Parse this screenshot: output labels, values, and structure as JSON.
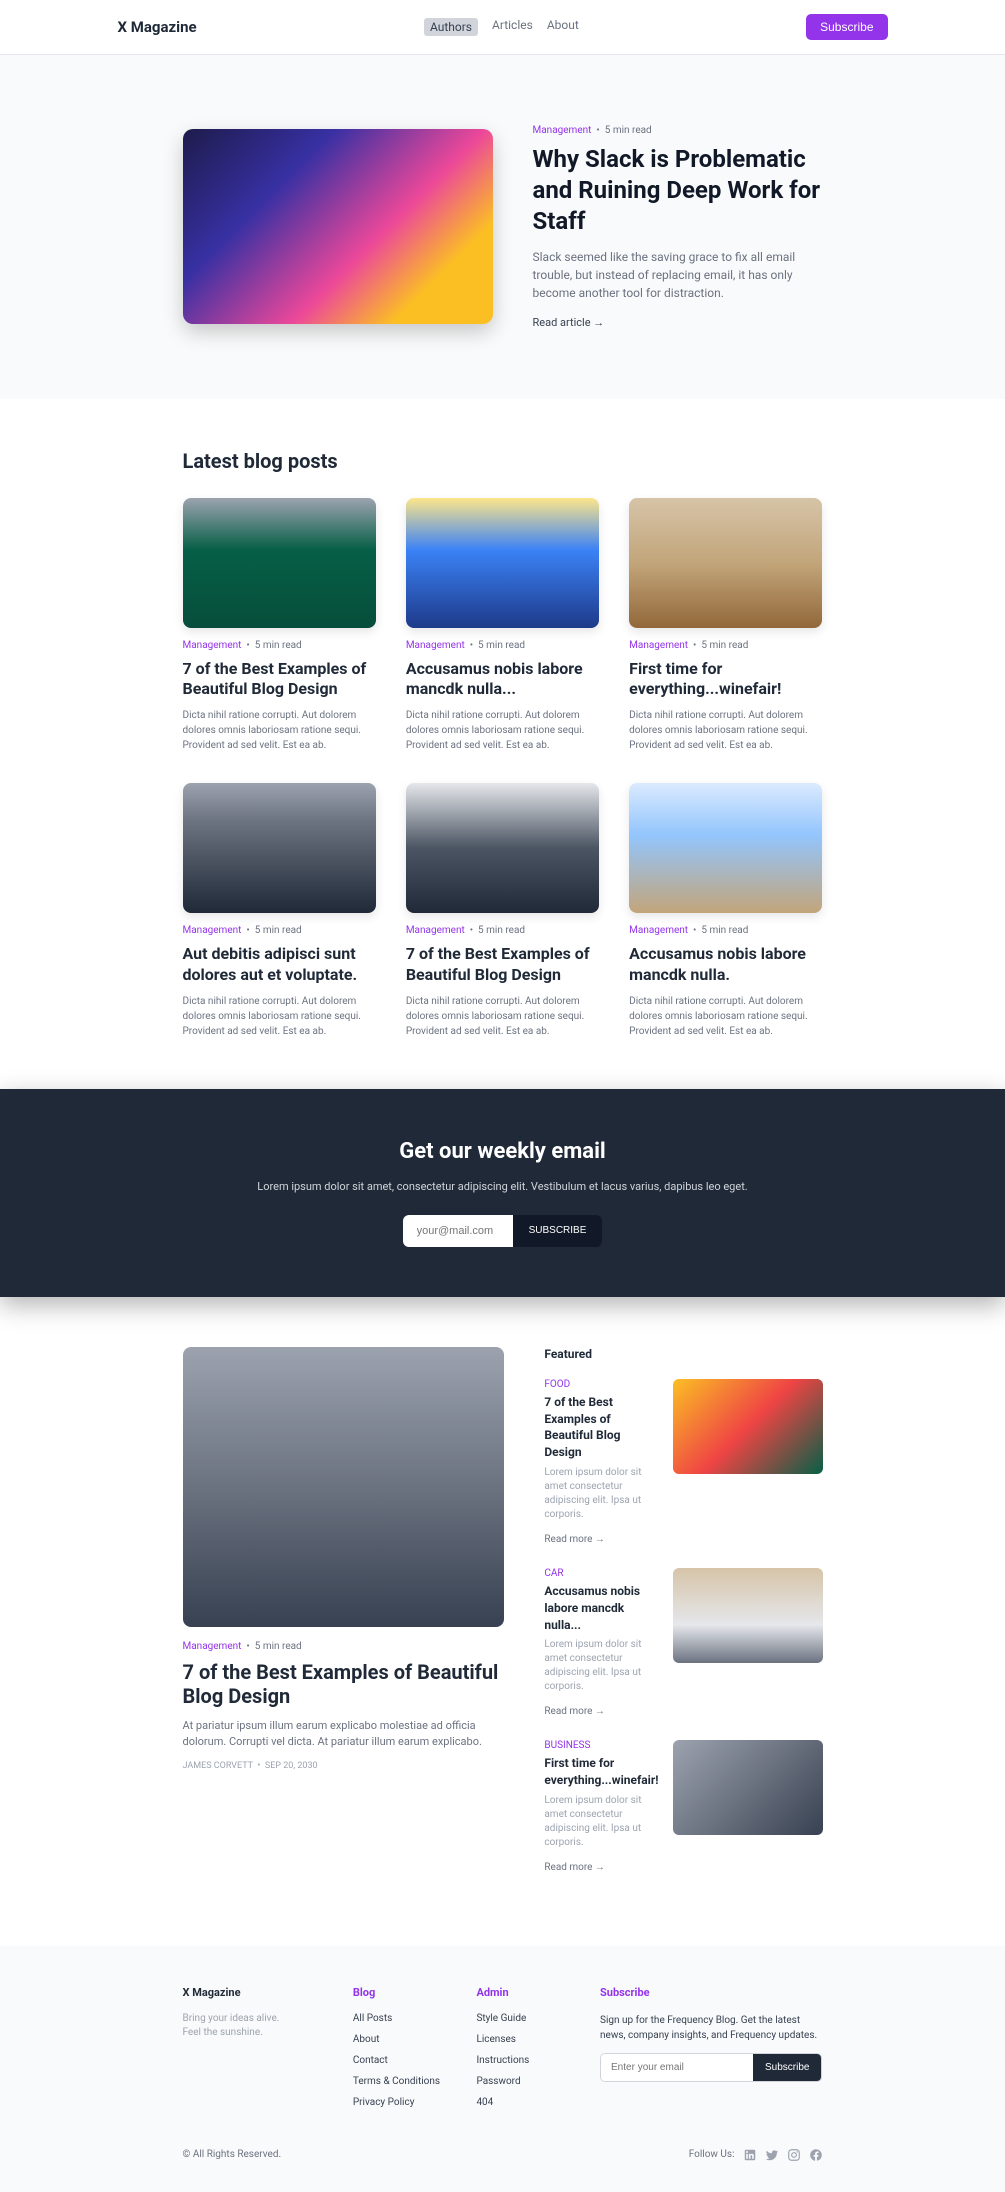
{
  "brand": "X Magazine",
  "nav": {
    "authors": "Authors",
    "articles": "Articles",
    "about": "About"
  },
  "subscribe_btn": "Subscribe",
  "hero": {
    "cat": "Management",
    "read": "5 min read",
    "title": "Why Slack is Problematic and Ruining Deep Work for Staff",
    "desc": "Slack seemed like the saving grace to fix all email trouble, but instead of replacing email, it has only become another tool for distraction.",
    "link": "Read article  →"
  },
  "latest": {
    "title": "Latest blog posts",
    "cat": "Management",
    "read": "5 min read",
    "excerpt": "Dicta nihil ratione corrupti. Aut dolorem dolores omnis laboriosam ratione sequi. Provident ad sed velit. Est ea ab.",
    "posts": [
      {
        "title": "7 of the Best Examples of Beautiful Blog Design"
      },
      {
        "title": "Accusamus nobis labore mancdk nulla..."
      },
      {
        "title": "First time for everything...winefair!"
      },
      {
        "title": "Aut debitis adipisci sunt dolores aut et voluptate."
      },
      {
        "title": "7 of the Best Examples of Beautiful Blog Design"
      },
      {
        "title": "Accusamus nobis labore mancdk nulla."
      }
    ]
  },
  "news": {
    "title": "Get our weekly email",
    "desc": "Lorem ipsum dolor sit amet, consectetur adipiscing elit. Vestibulum et lacus varius, dapibus leo eget.",
    "placeholder": "your@mail.com",
    "btn": "SUBSCRIBE"
  },
  "featured": {
    "label": "Featured",
    "main": {
      "cat": "Management",
      "read": "5 min read",
      "title": "7 of the Best Examples of Beautiful Blog Design",
      "desc": "At pariatur ipsum illum earum explicabo molestiae ad officia dolorum. Corrupti vel dicta. At pariatur illum earum explicabo.",
      "author": "JAMES CORVETT",
      "date": "SEP 20, 2030"
    },
    "items": [
      {
        "cat": "FOOD",
        "title": "7 of the Best Examples of Beautiful Blog Design",
        "desc": "Lorem ipsum dolor sit amet consectetur adipiscing elit. Ipsa ut corporis.",
        "rm": "Read more →"
      },
      {
        "cat": "CAR",
        "title": "Accusamus nobis labore mancdk nulla...",
        "desc": "Lorem ipsum dolor sit amet consectetur adipiscing elit. Ipsa ut corporis.",
        "rm": "Read more →"
      },
      {
        "cat": "BUSINESS",
        "title": "First time for everything...winefair!",
        "desc": "Lorem ipsum dolor sit amet consectetur adipiscing elit. Ipsa ut corporis.",
        "rm": "Read more →"
      }
    ]
  },
  "footer": {
    "brand": "X Magazine",
    "tag1": "Bring your ideas alive.",
    "tag2": "Feel the sunshine.",
    "blog": {
      "h": "Blog",
      "links": [
        "All Posts",
        "About",
        "Contact",
        "Terms & Conditions",
        "Privacy Policy"
      ]
    },
    "admin": {
      "h": "Admin",
      "links": [
        "Style Guide",
        "Licenses",
        "Instructions",
        "Password",
        "404"
      ]
    },
    "sub": {
      "h": "Subscribe",
      "p": "Sign up for the Frequency Blog.\nGet the latest news, company insights, and Frequency updates.",
      "placeholder": "Enter your email",
      "btn": "Subscribe"
    },
    "copy": "© All Rights Reserved.",
    "follow": "Follow Us:"
  }
}
